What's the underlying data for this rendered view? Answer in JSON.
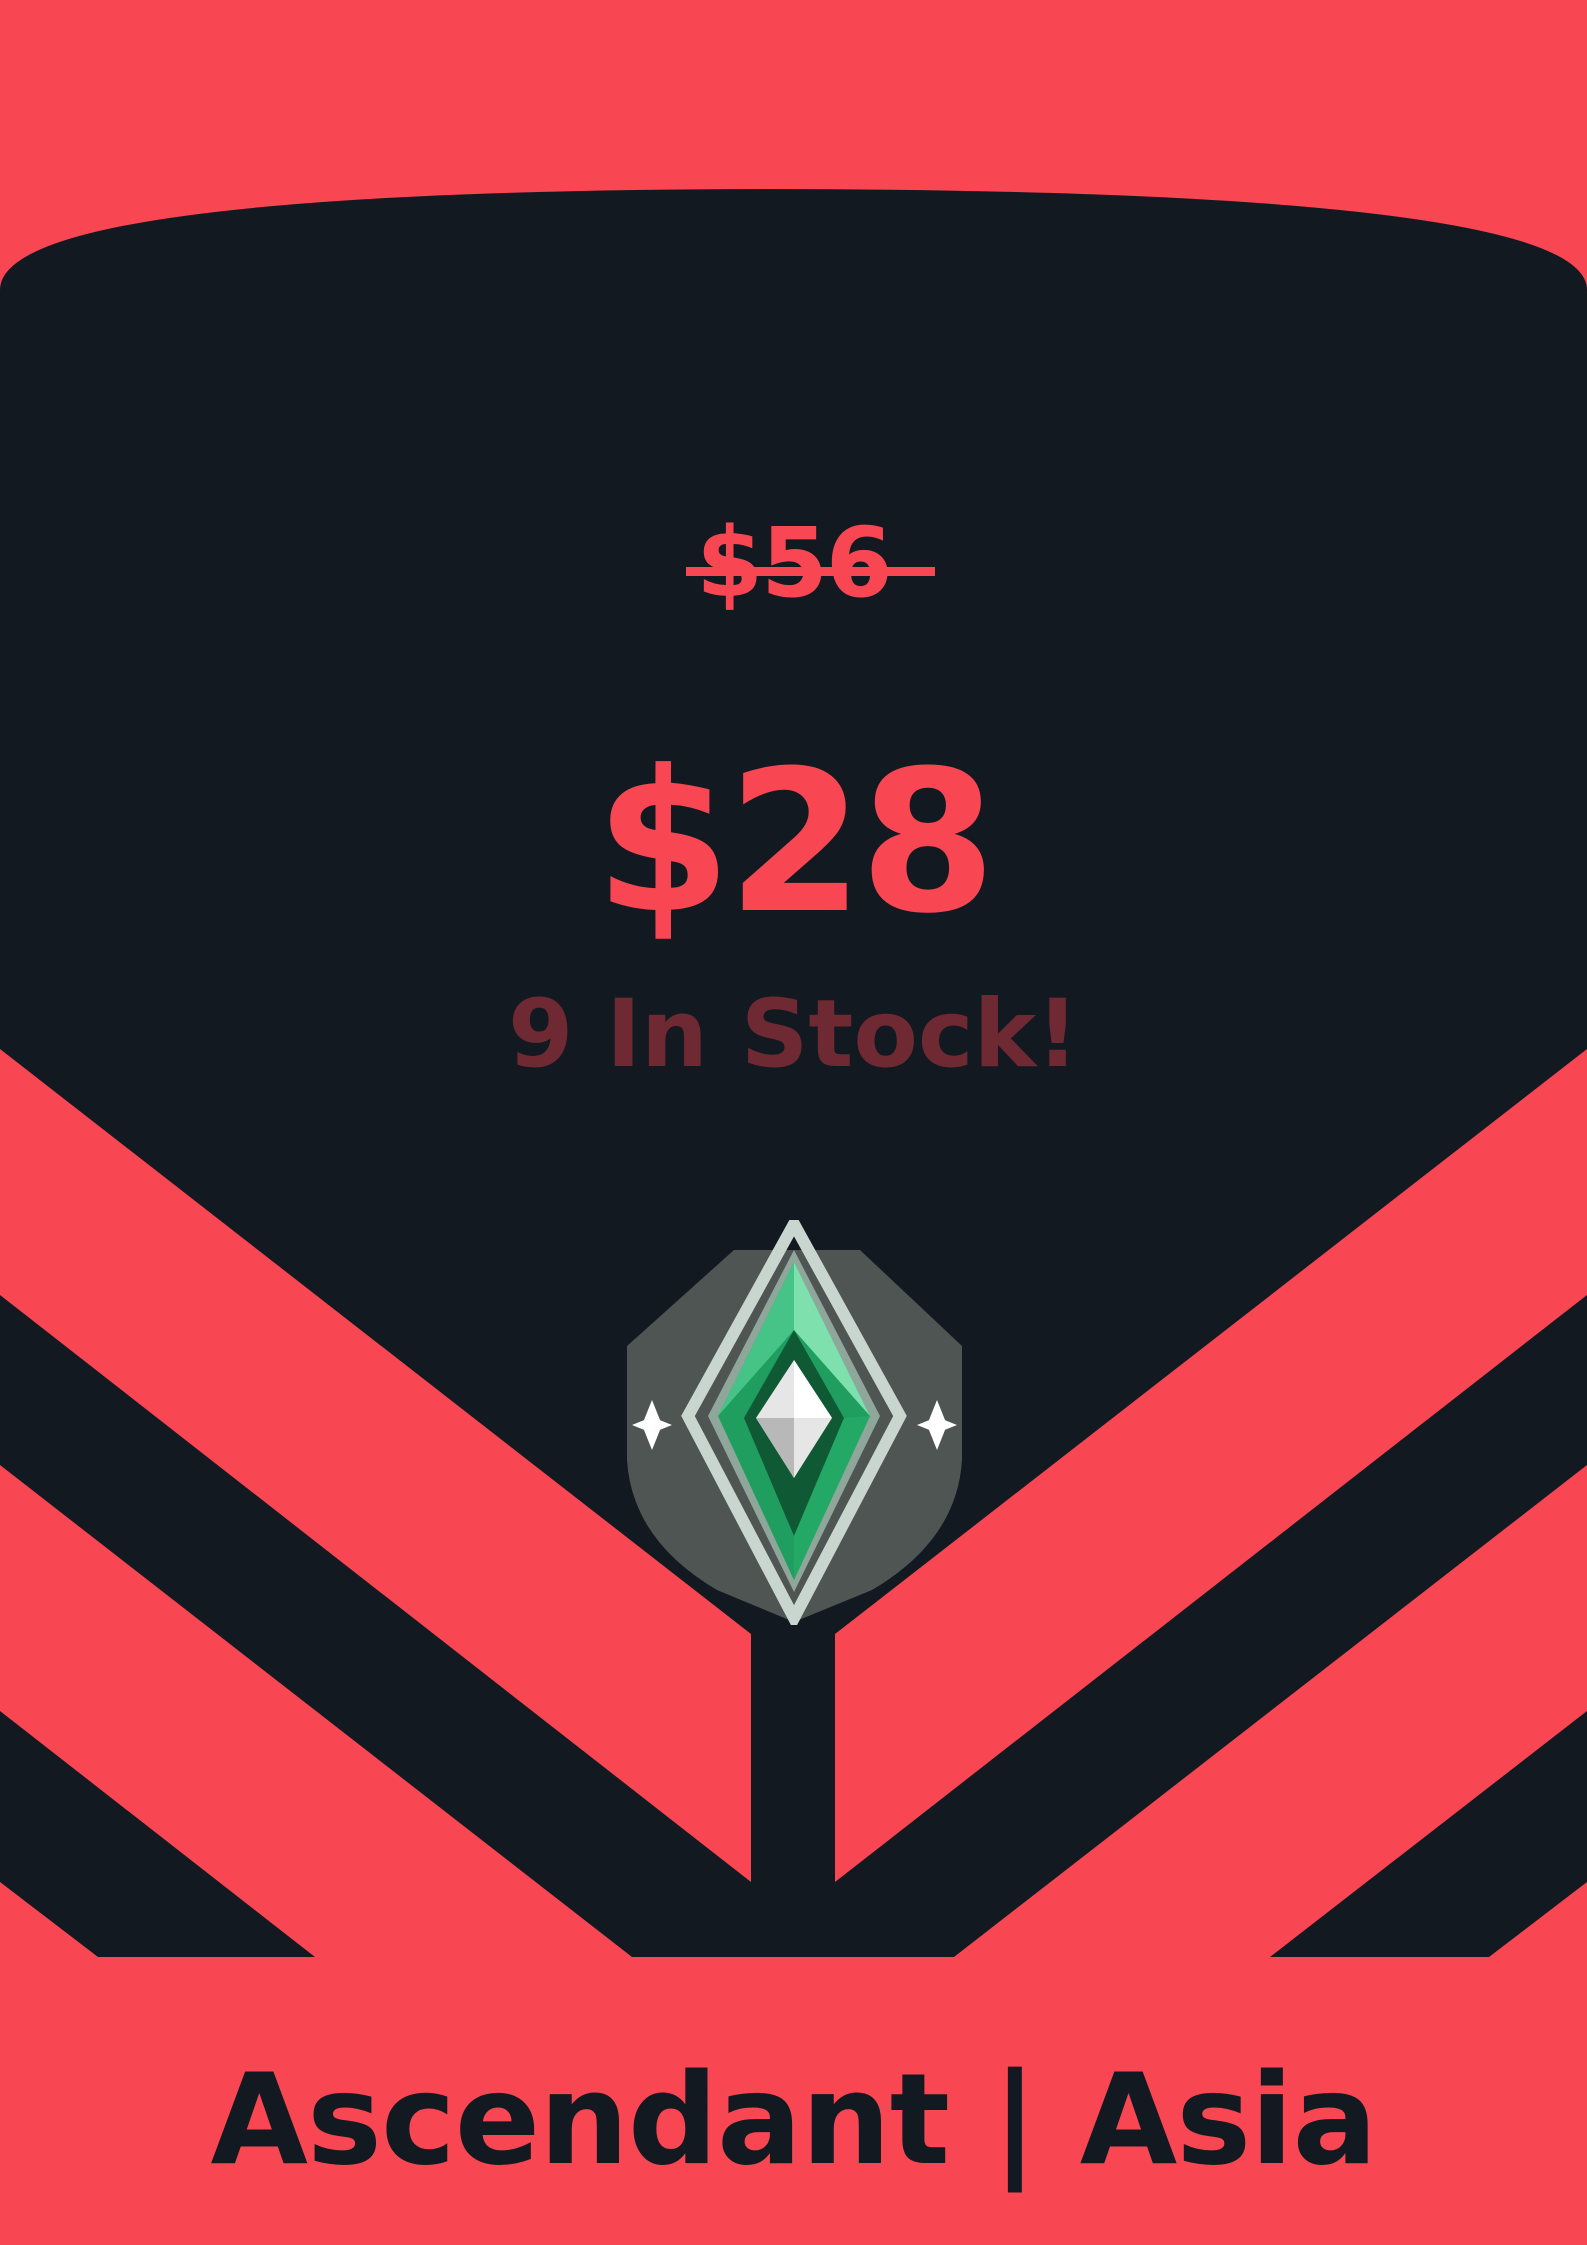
{
  "product": {
    "original_price": "$56",
    "sale_price": "$28",
    "stock_text": "9 In Stock!",
    "title": "Ascendant | Asia"
  },
  "icons": {
    "rank_emblem": "ascendant-rank-emblem-icon"
  },
  "colors": {
    "accent": "#f84753",
    "dark": "#131921",
    "stock_text": "#6e2932",
    "emblem_green": "#1f9e5f"
  }
}
